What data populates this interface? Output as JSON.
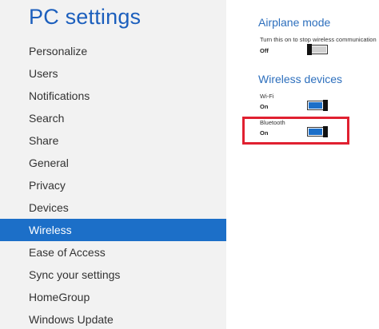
{
  "app": {
    "title": "PC settings"
  },
  "sidebar": {
    "items": [
      {
        "label": "Personalize"
      },
      {
        "label": "Users"
      },
      {
        "label": "Notifications"
      },
      {
        "label": "Search"
      },
      {
        "label": "Share"
      },
      {
        "label": "General"
      },
      {
        "label": "Privacy"
      },
      {
        "label": "Devices"
      },
      {
        "label": "Wireless",
        "selected": true
      },
      {
        "label": "Ease of Access"
      },
      {
        "label": "Sync your settings"
      },
      {
        "label": "HomeGroup"
      },
      {
        "label": "Windows Update"
      }
    ]
  },
  "airplane": {
    "title": "Airplane mode",
    "description": "Turn this on to stop wireless communication",
    "state": "Off",
    "on": false
  },
  "wireless_devices": {
    "title": "Wireless devices",
    "wifi": {
      "label": "Wi-Fi",
      "state": "On",
      "on": true
    },
    "bluetooth": {
      "label": "Bluetooth",
      "state": "On",
      "on": true
    }
  },
  "colors": {
    "accent": "#1c6fc8",
    "title": "#1c5fbd",
    "highlight": "#e02030",
    "sidebar_bg": "#f2f2f2"
  }
}
